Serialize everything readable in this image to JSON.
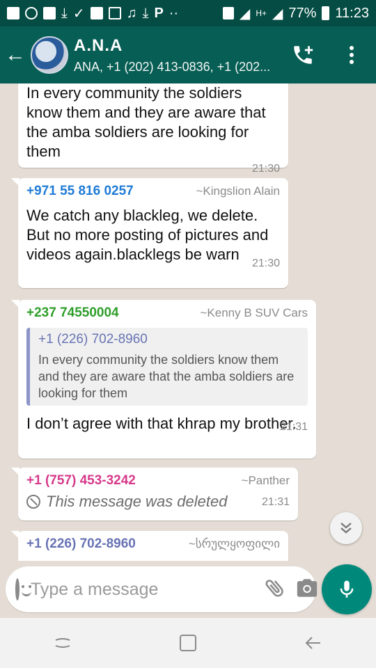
{
  "status_bar": {
    "battery": "77%",
    "time": "11:23"
  },
  "header": {
    "title": "A.N.A",
    "subtitle": "ANA, +1 (202) 413-0836, +1 (202..."
  },
  "messages": [
    {
      "text": "In every community the soldiers know them and they are aware that the amba soldiers are looking for them",
      "time": "21:30"
    },
    {
      "sender": "+971 55 816 0257",
      "alias": "~Kingslion Alain",
      "text": "We catch any blackleg, we delete. But no more posting of pictures and videos again.blacklegs be warn",
      "time": "21:30",
      "sender_color": "#1f7bd6"
    },
    {
      "sender": "+237 74550004",
      "alias": "~Kenny B SUV Cars",
      "quote_sender": "+1 (226) 702-8960",
      "quote_text": "In every community the soldiers know them and they are aware that the amba soldiers are looking for them",
      "text": "I don’t agree with that khrap my brother.",
      "time": "21:31",
      "sender_color": "#2e9e2a"
    },
    {
      "sender": "+1 (757) 453-3242",
      "alias": "~Panther",
      "deleted_text": "This message was deleted",
      "time": "21:31",
      "sender_color": "#d6398a"
    },
    {
      "sender": "+1 (226) 702-8960",
      "alias": "~სრულყოფილი",
      "sender_color": "#6873b4"
    }
  ],
  "input": {
    "placeholder": "Type a message"
  },
  "colors": {
    "header": "#075e54",
    "status_bar": "#054d44",
    "accent": "#00897b",
    "chat_bg": "#e5ddd5"
  },
  "icons": [
    "back-arrow-icon",
    "add-call-icon",
    "more-vert-icon",
    "scroll-down-icon",
    "emoji-icon",
    "attach-icon",
    "camera-icon",
    "mic-icon",
    "recents-icon",
    "home-icon",
    "back-nav-icon"
  ]
}
